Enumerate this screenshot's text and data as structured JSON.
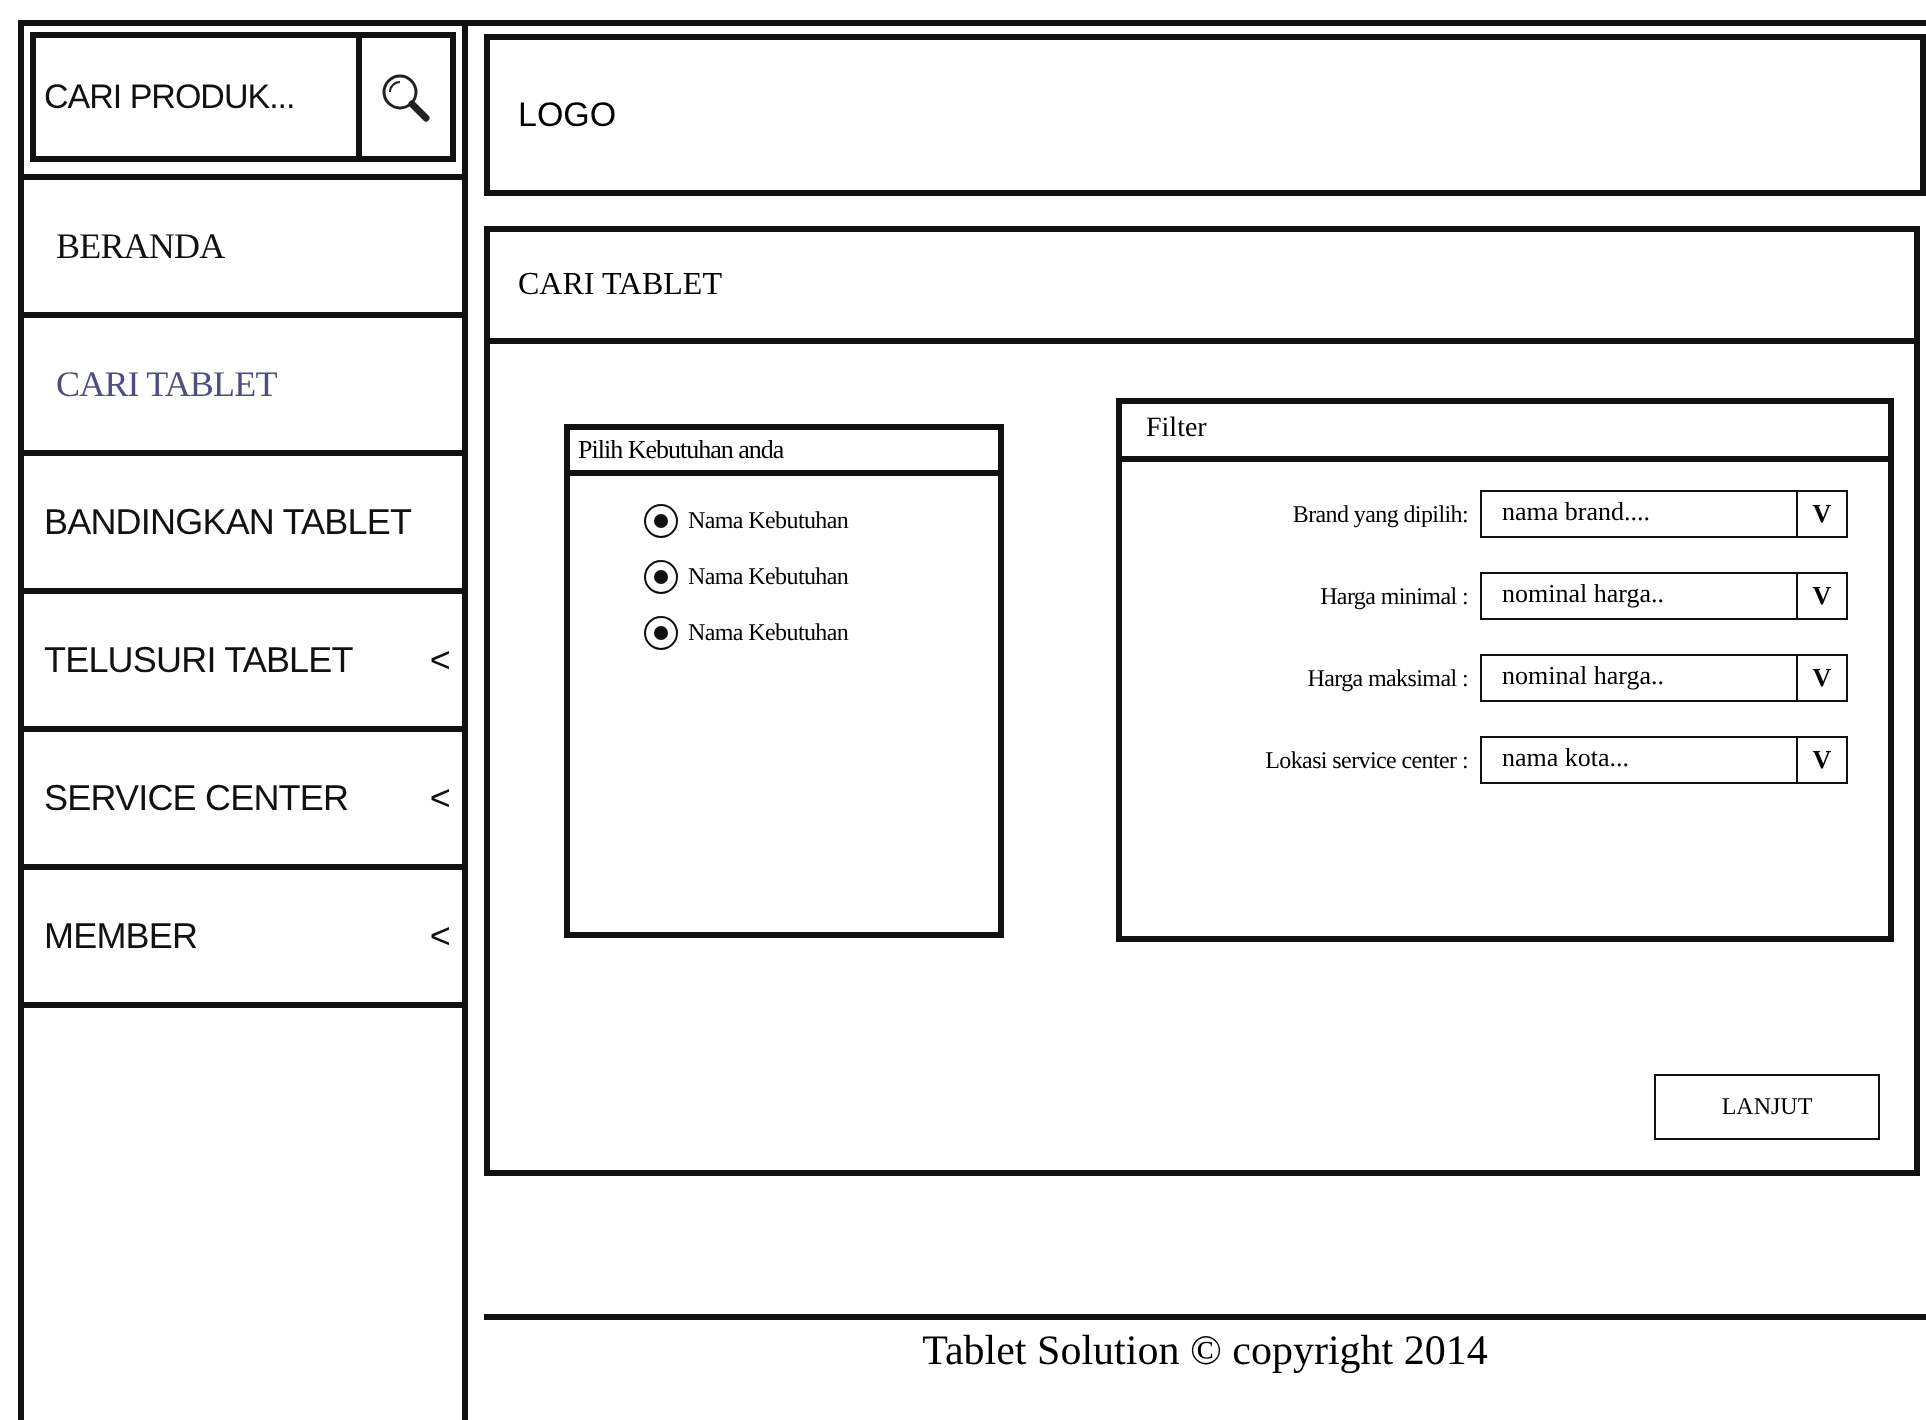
{
  "search": {
    "placeholder": "CARI PRODUK..."
  },
  "logo": "LOGO",
  "sidebar": {
    "items": [
      {
        "label": "BERANDA",
        "selected": false
      },
      {
        "label": "CARI TABLET",
        "selected": true
      },
      {
        "label": "BANDINGKAN TABLET",
        "selected": false
      },
      {
        "label": "TELUSURI TABLET",
        "selected": false,
        "chevron": "<"
      },
      {
        "label": "SERVICE CENTER",
        "selected": false,
        "chevron": "<"
      },
      {
        "label": "MEMBER",
        "selected": false,
        "chevron": "<"
      }
    ]
  },
  "panel": {
    "title": "CARI TABLET",
    "needs": {
      "title": "Pilih Kebutuhan anda",
      "options": [
        {
          "label": "Nama Kebutuhan",
          "selected": true
        },
        {
          "label": "Nama Kebutuhan",
          "selected": true
        },
        {
          "label": "Nama Kebutuhan",
          "selected": true
        }
      ]
    },
    "filter": {
      "title": "Filter",
      "fields": [
        {
          "label": "Brand yang dipilih:",
          "value": "nama brand....",
          "arrow": "V"
        },
        {
          "label": "Harga minimal :",
          "value": "nominal harga..",
          "arrow": "V"
        },
        {
          "label": "Harga maksimal :",
          "value": "nominal harga..",
          "arrow": "V"
        },
        {
          "label": "Lokasi service center :",
          "value": "nama kota...",
          "arrow": "V"
        }
      ]
    },
    "button": "LANJUT"
  },
  "footer": "Tablet Solution © copyright 2014"
}
